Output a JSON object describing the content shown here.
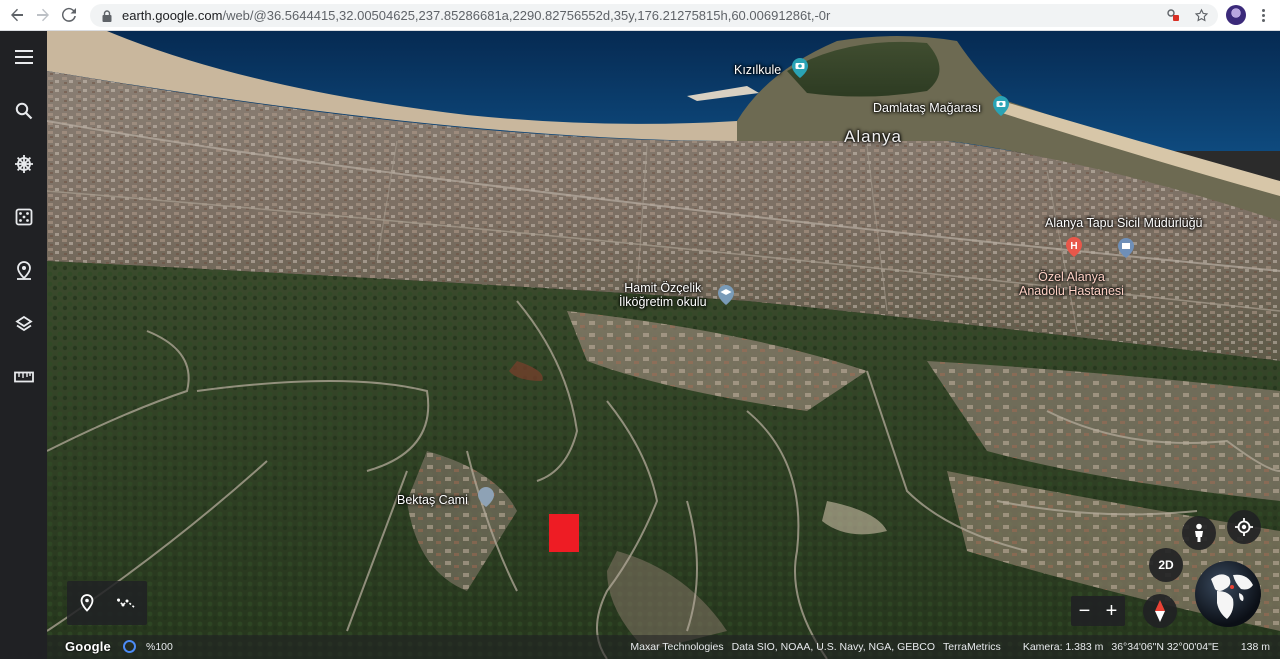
{
  "browser": {
    "url_host": "earth.google.com",
    "url_path": "/web/@36.5644415,32.00504625,237.85286681a,2290.82756552d,35y,176.21275815h,60.00691286t,-0r"
  },
  "map_labels": {
    "kizilkule": "Kızılkule",
    "damlatas": "Damlataş Mağarası",
    "alanya": "Alanya",
    "tapu": "Alanya Tapu Sicil Müdürlüğü",
    "hastane_line1": "Özel Alanya",
    "hastane_line2": "Anadolu Hastanesi",
    "okul_line1": "Hamit Özçelik",
    "okul_line2": "İlköğretim okulu",
    "bektas": "Bektaş Cami"
  },
  "controls": {
    "view_2d": "2D",
    "zoom_out": "−",
    "zoom_in": "+"
  },
  "status": {
    "logo": "Google",
    "load_pct": "%100",
    "credit_maxar": "Maxar Technologies",
    "credit_data": "Data SIO, NOAA, U.S. Navy, NGA, GEBCO",
    "credit_terra": "TerraMetrics",
    "camera": "Kamera: 1.383 m",
    "coords": "36°34'06\"N 32°00'04\"E",
    "elevation": "138 m"
  },
  "colors": {
    "sea": "#0c3d6e",
    "marker": "#ee1c24",
    "hospital_pin": "#e8574a",
    "poi_pin": "#2aa3b5"
  },
  "icons": {
    "menu": "hamburger-icon",
    "search": "search-icon",
    "voyager": "ship-wheel-icon",
    "feeling_lucky": "dice-icon",
    "projects": "map-pin-icon",
    "layers": "layers-icon",
    "measure": "ruler-icon"
  }
}
